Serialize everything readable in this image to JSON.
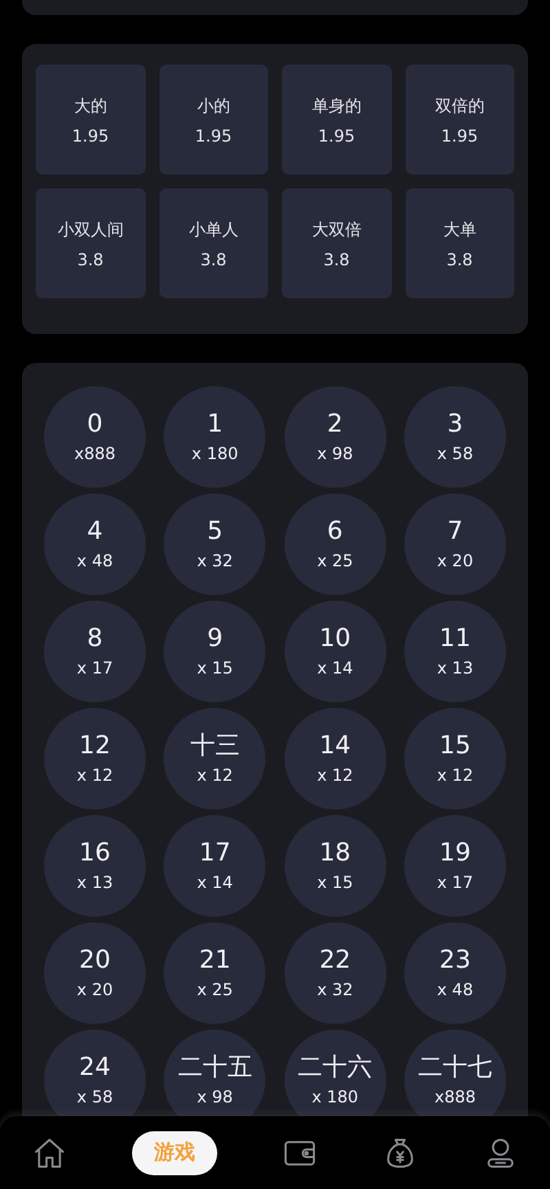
{
  "odds_tiles": [
    {
      "label": "大的",
      "odds": "1.95"
    },
    {
      "label": "小的",
      "odds": "1.95"
    },
    {
      "label": "单身的",
      "odds": "1.95"
    },
    {
      "label": "双倍的",
      "odds": "1.95"
    },
    {
      "label": "小双人间",
      "odds": "3.8"
    },
    {
      "label": "小单人",
      "odds": "3.8"
    },
    {
      "label": "大双倍",
      "odds": "3.8"
    },
    {
      "label": "大单",
      "odds": "3.8"
    }
  ],
  "numbers": [
    {
      "number": "0",
      "payout": "x888"
    },
    {
      "number": "1",
      "payout": "x 180"
    },
    {
      "number": "2",
      "payout": "x 98"
    },
    {
      "number": "3",
      "payout": "x 58"
    },
    {
      "number": "4",
      "payout": "x 48"
    },
    {
      "number": "5",
      "payout": "x 32"
    },
    {
      "number": "6",
      "payout": "x 25"
    },
    {
      "number": "7",
      "payout": "x 20"
    },
    {
      "number": "8",
      "payout": "x 17"
    },
    {
      "number": "9",
      "payout": "x 15"
    },
    {
      "number": "10",
      "payout": "x 14"
    },
    {
      "number": "11",
      "payout": "x 13"
    },
    {
      "number": "12",
      "payout": "x 12"
    },
    {
      "number": "十三",
      "payout": "x 12"
    },
    {
      "number": "14",
      "payout": "x 12"
    },
    {
      "number": "15",
      "payout": "x 12"
    },
    {
      "number": "16",
      "payout": "x 13"
    },
    {
      "number": "17",
      "payout": "x 14"
    },
    {
      "number": "18",
      "payout": "x 15"
    },
    {
      "number": "19",
      "payout": "x 17"
    },
    {
      "number": "20",
      "payout": "x 20"
    },
    {
      "number": "21",
      "payout": "x 25"
    },
    {
      "number": "22",
      "payout": "x 32"
    },
    {
      "number": "23",
      "payout": "x 48"
    },
    {
      "number": "24",
      "payout": "x 58"
    },
    {
      "number": "二十五",
      "payout": "x 98"
    },
    {
      "number": "二十六",
      "payout": "x 180"
    },
    {
      "number": "二十七",
      "payout": "x888"
    }
  ],
  "bottom_nav": [
    {
      "kind": "home",
      "selected": false
    },
    {
      "kind": "game",
      "label": "游戏",
      "selected": true
    },
    {
      "kind": "wallet",
      "selected": false
    },
    {
      "kind": "moneybag",
      "selected": false
    },
    {
      "kind": "user",
      "selected": false
    }
  ]
}
